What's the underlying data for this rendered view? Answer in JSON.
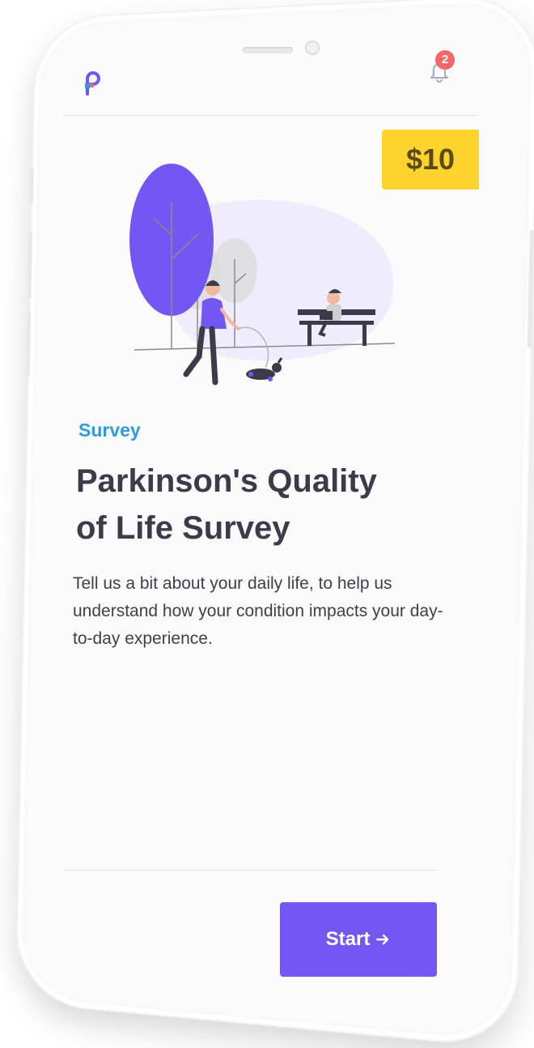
{
  "header": {
    "notification_count": "2"
  },
  "reward": {
    "label": "$10"
  },
  "content": {
    "category": "Survey",
    "title": "Parkinson's Quality of Life Survey",
    "description": "Tell us a bit about your daily life, to help us understand how your condition impacts your day-to-day experience."
  },
  "actions": {
    "start_label": "Start",
    "start_icon": "arrow-right-icon"
  },
  "colors": {
    "accent": "#7357f2",
    "price_bg": "#fdd32e",
    "category": "#2e9bdc",
    "badge": "#f2686a"
  }
}
